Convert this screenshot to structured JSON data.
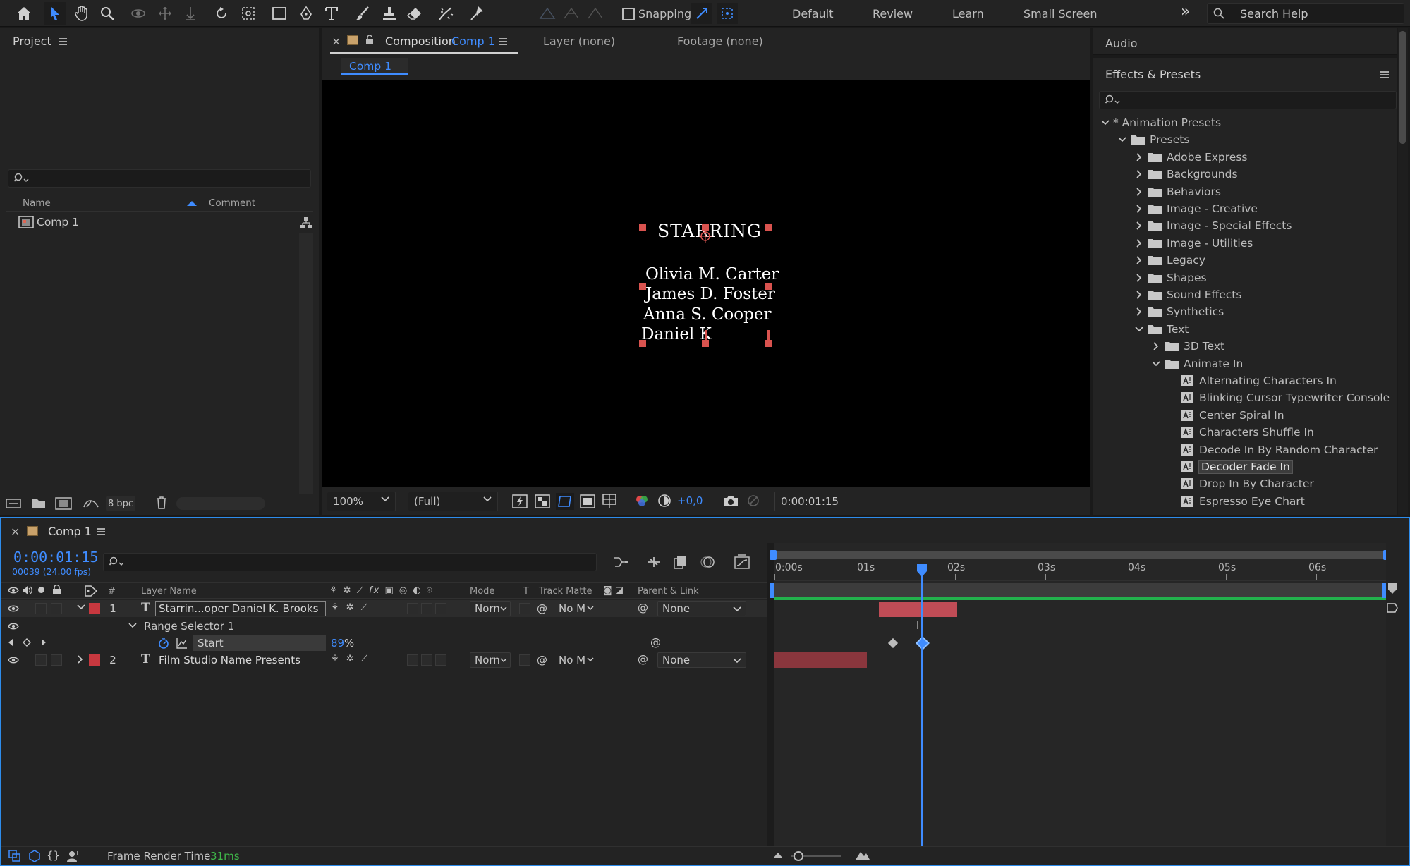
{
  "toolbar": {
    "snapping_label": "Snapping",
    "workspaces": [
      "Default",
      "Review",
      "Learn",
      "Small Screen"
    ],
    "search_placeholder": "Search Help"
  },
  "project_panel": {
    "title": "Project",
    "columns": {
      "name": "Name",
      "comment": "Comment"
    },
    "items": [
      {
        "name": "Comp 1",
        "icon": "composition-icon"
      }
    ],
    "bpc": "8 bpc"
  },
  "composition_panel": {
    "tab_label": "Composition",
    "tab_comp": "Comp 1",
    "layer_tab": "Layer (none)",
    "footage_tab": "Footage (none)",
    "breadcrumb": "Comp 1",
    "zoom": "100%",
    "resolution": "(Full)",
    "exposure": "+0,0",
    "timecode": "0:00:01:15",
    "viewer_text": {
      "heading": "STARRING",
      "names": [
        "Olivia M. Carter",
        "James D. Foster",
        "Anna S. Cooper",
        "Daniel K"
      ]
    }
  },
  "right_panels": {
    "audio_title": "Audio",
    "effects_title": "Effects & Presets",
    "tree": [
      {
        "label": "* Animation Presets",
        "level": 0,
        "type": "root",
        "open": true
      },
      {
        "label": "Presets",
        "level": 1,
        "type": "folder",
        "open": true
      },
      {
        "label": "Adobe Express",
        "level": 2,
        "type": "folder",
        "open": false
      },
      {
        "label": "Backgrounds",
        "level": 2,
        "type": "folder",
        "open": false
      },
      {
        "label": "Behaviors",
        "level": 2,
        "type": "folder",
        "open": false
      },
      {
        "label": "Image - Creative",
        "level": 2,
        "type": "folder",
        "open": false
      },
      {
        "label": "Image - Special Effects",
        "level": 2,
        "type": "folder",
        "open": false
      },
      {
        "label": "Image - Utilities",
        "level": 2,
        "type": "folder",
        "open": false
      },
      {
        "label": "Legacy",
        "level": 2,
        "type": "folder",
        "open": false
      },
      {
        "label": "Shapes",
        "level": 2,
        "type": "folder",
        "open": false
      },
      {
        "label": "Sound Effects",
        "level": 2,
        "type": "folder",
        "open": false
      },
      {
        "label": "Synthetics",
        "level": 2,
        "type": "folder",
        "open": false
      },
      {
        "label": "Text",
        "level": 2,
        "type": "folder",
        "open": true
      },
      {
        "label": "3D Text",
        "level": 3,
        "type": "folder",
        "open": false
      },
      {
        "label": "Animate In",
        "level": 3,
        "type": "folder",
        "open": true
      },
      {
        "label": "Alternating Characters In",
        "level": 4,
        "type": "preset"
      },
      {
        "label": "Blinking Cursor Typewriter Console",
        "level": 4,
        "type": "preset"
      },
      {
        "label": "Center Spiral In",
        "level": 4,
        "type": "preset"
      },
      {
        "label": "Characters Shuffle In",
        "level": 4,
        "type": "preset"
      },
      {
        "label": "Decode In By Random Character",
        "level": 4,
        "type": "preset"
      },
      {
        "label": "Decoder Fade In",
        "level": 4,
        "type": "preset",
        "selected": true
      },
      {
        "label": "Drop In By Character",
        "level": 4,
        "type": "preset"
      },
      {
        "label": "Espresso Eye Chart",
        "level": 4,
        "type": "preset"
      }
    ]
  },
  "timeline": {
    "tab": "Comp 1",
    "timecode": "0:00:01:15",
    "frame_info": "00039 (24.00 fps)",
    "columns": {
      "num": "#",
      "layer_name": "Layer Name",
      "mode": "Mode",
      "t": "T",
      "track_matte": "Track Matte",
      "parent": "Parent & Link"
    },
    "layers": [
      {
        "num": "1",
        "name": "Starrin...oper Daniel K. Brooks",
        "mode": "Norn",
        "matte": "No M",
        "parent": "None",
        "label_color": "#c8383f"
      },
      {
        "num": "2",
        "name": "Film Studio Name Presents",
        "mode": "Norn",
        "matte": "No M",
        "parent": "None",
        "label_color": "#c8383f"
      }
    ],
    "range_selector": "Range Selector 1",
    "start_prop": {
      "name": "Start",
      "value": "89",
      "unit": "%"
    },
    "ruler": [
      "0:00s",
      "01s",
      "02s",
      "03s",
      "04s",
      "05s",
      "06s"
    ],
    "footer": {
      "label": "Frame Render Time",
      "value": "31ms"
    }
  }
}
